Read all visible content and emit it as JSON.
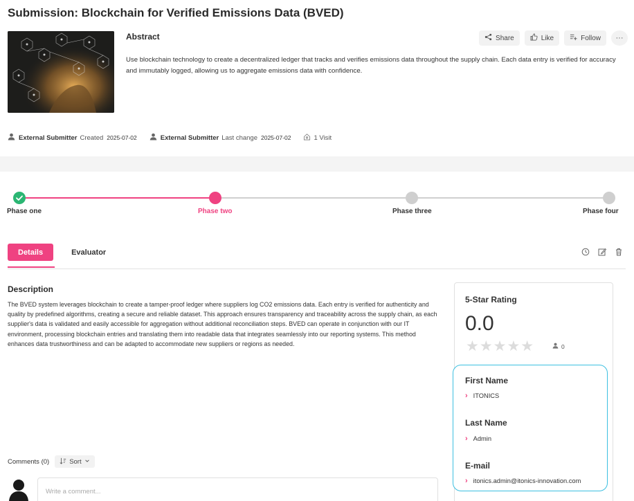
{
  "page": {
    "title": "Submission: Blockchain for Verified Emissions Data (BVED)"
  },
  "abstract": {
    "label": "Abstract",
    "text": "Use blockchain technology to create a decentralized ledger that tracks and verifies emissions data throughout the supply chain. Each data entry is verified for accuracy and immutably logged, allowing us to aggregate emissions data with confidence."
  },
  "actions": {
    "share": "Share",
    "like": "Like",
    "follow": "Follow",
    "more": "···"
  },
  "meta": {
    "creator": "External Submitter",
    "created_label": "Created",
    "created_date": "2025-07-02",
    "modifier": "External Submitter",
    "last_change_label": "Last change",
    "last_change_date": "2025-07-02",
    "visits": "1 Visit"
  },
  "phases": [
    {
      "label": "Phase one",
      "state": "done"
    },
    {
      "label": "Phase two",
      "state": "current"
    },
    {
      "label": "Phase three",
      "state": "upcoming"
    },
    {
      "label": "Phase four",
      "state": "upcoming"
    }
  ],
  "tabs": {
    "details": "Details",
    "evaluator": "Evaluator"
  },
  "description": {
    "title": "Description",
    "text": "The BVED system leverages blockchain to create a tamper-proof ledger where suppliers log CO2 emissions data. Each entry is verified for authenticity and quality by predefined algorithms, creating a secure and reliable dataset. This approach ensures transparency and traceability across the supply chain, as each supplier's data is validated and easily accessible for aggregation without additional reconciliation steps. BVED can operate in conjunction with our IT environment, processing blockchain entries and translating them into readable data that integrates seamlessly into our reporting systems. This method enhances data trustworthiness and can be adapted to accommodate new suppliers or regions as needed."
  },
  "rating": {
    "title": "5-Star Rating",
    "value": "0.0",
    "stars": "★★★★★",
    "count": "0"
  },
  "user": {
    "first_name_label": "First Name",
    "first_name": "ITONICS",
    "last_name_label": "Last Name",
    "last_name": "Admin",
    "email_label": "E-mail",
    "email": "itonics.admin@itonics-innovation.com"
  },
  "comments": {
    "label": "Comments (0)",
    "sort": "Sort",
    "placeholder": "Write a comment..."
  },
  "colors": {
    "accent": "#ef4281",
    "success": "#2bb673",
    "inactive": "#cfcfcf",
    "highlight_border": "#3bbfe0"
  }
}
